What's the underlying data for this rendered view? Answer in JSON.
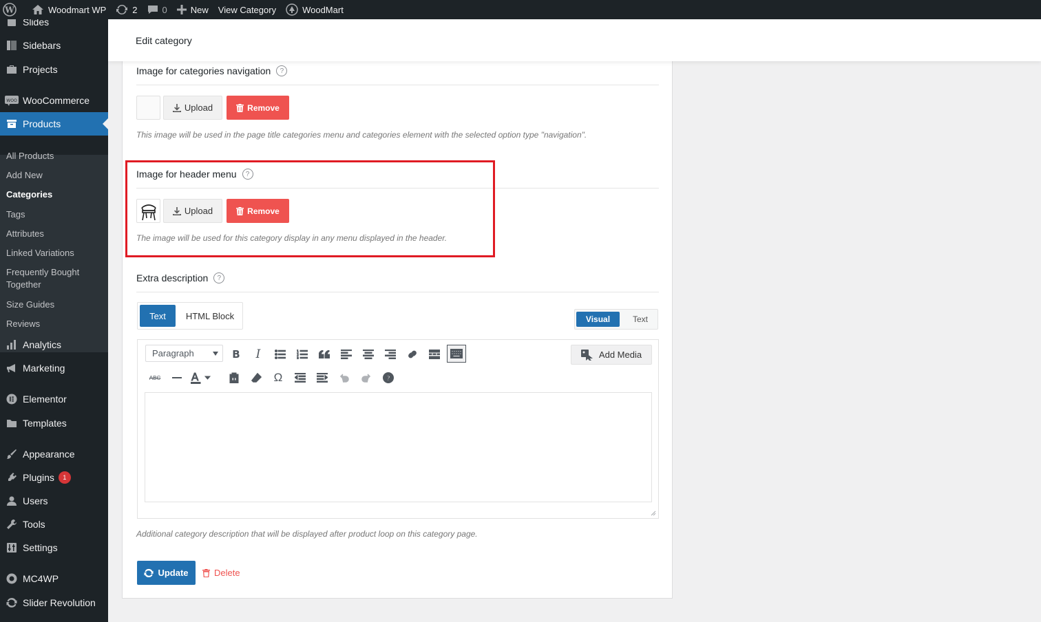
{
  "adminbar": {
    "site_name": "Woodmart WP",
    "updates_count": "2",
    "comments_count": "0",
    "new_label": "New",
    "view_label": "View Category",
    "woodmart_label": "WoodMart"
  },
  "sidebar": {
    "items": [
      {
        "label": "Slides"
      },
      {
        "label": "Sidebars"
      },
      {
        "label": "Projects"
      },
      {
        "label": "WooCommerce"
      },
      {
        "label": "Products"
      },
      {
        "label": "Analytics"
      },
      {
        "label": "Marketing"
      },
      {
        "label": "Elementor"
      },
      {
        "label": "Templates"
      },
      {
        "label": "Appearance"
      },
      {
        "label": "Plugins",
        "badge": "1"
      },
      {
        "label": "Users"
      },
      {
        "label": "Tools"
      },
      {
        "label": "Settings"
      },
      {
        "label": "MC4WP"
      },
      {
        "label": "Slider Revolution"
      }
    ],
    "submenu": [
      {
        "label": "All Products"
      },
      {
        "label": "Add New"
      },
      {
        "label": "Categories"
      },
      {
        "label": "Tags"
      },
      {
        "label": "Attributes"
      },
      {
        "label": "Linked Variations"
      },
      {
        "label": "Frequently Bought Together"
      },
      {
        "label": "Size Guides"
      },
      {
        "label": "Reviews"
      }
    ]
  },
  "header": {
    "title": "Edit category"
  },
  "sections": {
    "nav_image": {
      "label": "Image for categories navigation",
      "upload": "Upload",
      "remove": "Remove",
      "description": "This image will be used in the page title categories menu and categories element with the selected option type \"navigation\"."
    },
    "header_image": {
      "label": "Image for header menu",
      "upload": "Upload",
      "remove": "Remove",
      "description": "The image will be used for this category display in any menu displayed in the header."
    },
    "extra_description": {
      "label": "Extra description",
      "tab_text": "Text",
      "tab_html": "HTML Block",
      "visual": "Visual",
      "text": "Text",
      "format_select": "Paragraph",
      "add_media": "Add Media",
      "help_text": "Additional category description that will be displayed after product loop on this category page."
    }
  },
  "actions": {
    "update": "Update",
    "delete": "Delete"
  },
  "colors": {
    "accent": "#2271b1",
    "danger": "#ef5350",
    "highlight": "#e01b24",
    "admin_bg": "#1d2327"
  }
}
